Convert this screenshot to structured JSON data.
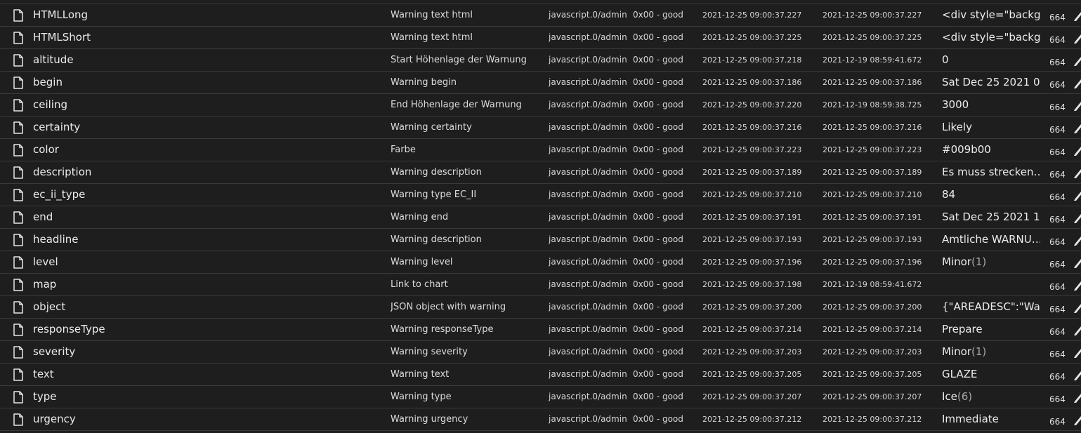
{
  "permission": "664",
  "rows": [
    {
      "name": "HTMLLong",
      "description": "Warning text html",
      "from": "javascript.0/admin",
      "quality": "0x00 - good",
      "timestamp": "2021-12-25 09:00:37.227",
      "last_change": "2021-12-25 09:00:37.227",
      "value": "<div style=\"backg…",
      "value_ann": ""
    },
    {
      "name": "HTMLShort",
      "description": "Warning text html",
      "from": "javascript.0/admin",
      "quality": "0x00 - good",
      "timestamp": "2021-12-25 09:00:37.225",
      "last_change": "2021-12-25 09:00:37.225",
      "value": "<div style=\"backg…",
      "value_ann": ""
    },
    {
      "name": "altitude",
      "description": "Start Höhenlage der Warnung",
      "from": "javascript.0/admin",
      "quality": "0x00 - good",
      "timestamp": "2021-12-25 09:00:37.218",
      "last_change": "2021-12-19 08:59:41.672",
      "value": "0",
      "value_ann": ""
    },
    {
      "name": "begin",
      "description": "Warning begin",
      "from": "javascript.0/admin",
      "quality": "0x00 - good",
      "timestamp": "2021-12-25 09:00:37.186",
      "last_change": "2021-12-25 09:00:37.186",
      "value": "Sat Dec 25 2021 0…",
      "value_ann": ""
    },
    {
      "name": "ceiling",
      "description": "End Höhenlage der Warnung",
      "from": "javascript.0/admin",
      "quality": "0x00 - good",
      "timestamp": "2021-12-25 09:00:37.220",
      "last_change": "2021-12-19 08:59:38.725",
      "value": "3000",
      "value_ann": ""
    },
    {
      "name": "certainty",
      "description": "Warning certainty",
      "from": "javascript.0/admin",
      "quality": "0x00 - good",
      "timestamp": "2021-12-25 09:00:37.216",
      "last_change": "2021-12-25 09:00:37.216",
      "value": "Likely",
      "value_ann": ""
    },
    {
      "name": "color",
      "description": "Farbe",
      "from": "javascript.0/admin",
      "quality": "0x00 - good",
      "timestamp": "2021-12-25 09:00:37.223",
      "last_change": "2021-12-25 09:00:37.223",
      "value": "#009b00",
      "value_ann": ""
    },
    {
      "name": "description",
      "description": "Warning description",
      "from": "javascript.0/admin",
      "quality": "0x00 - good",
      "timestamp": "2021-12-25 09:00:37.189",
      "last_change": "2021-12-25 09:00:37.189",
      "value": "Es muss strecken…",
      "value_ann": ""
    },
    {
      "name": "ec_ii_type",
      "description": "Warning type EC_II",
      "from": "javascript.0/admin",
      "quality": "0x00 - good",
      "timestamp": "2021-12-25 09:00:37.210",
      "last_change": "2021-12-25 09:00:37.210",
      "value": "84",
      "value_ann": ""
    },
    {
      "name": "end",
      "description": "Warning end",
      "from": "javascript.0/admin",
      "quality": "0x00 - good",
      "timestamp": "2021-12-25 09:00:37.191",
      "last_change": "2021-12-25 09:00:37.191",
      "value": "Sat Dec 25 2021 1…",
      "value_ann": ""
    },
    {
      "name": "headline",
      "description": "Warning description",
      "from": "javascript.0/admin",
      "quality": "0x00 - good",
      "timestamp": "2021-12-25 09:00:37.193",
      "last_change": "2021-12-25 09:00:37.193",
      "value": "Amtliche WARNU…",
      "value_ann": ""
    },
    {
      "name": "level",
      "description": "Warning level",
      "from": "javascript.0/admin",
      "quality": "0x00 - good",
      "timestamp": "2021-12-25 09:00:37.196",
      "last_change": "2021-12-25 09:00:37.196",
      "value": "Minor",
      "value_ann": "(1)"
    },
    {
      "name": "map",
      "description": "Link to chart",
      "from": "javascript.0/admin",
      "quality": "0x00 - good",
      "timestamp": "2021-12-25 09:00:37.198",
      "last_change": "2021-12-19 08:59:41.672",
      "value": "",
      "value_ann": ""
    },
    {
      "name": "object",
      "description": "JSON object with warning",
      "from": "javascript.0/admin",
      "quality": "0x00 - good",
      "timestamp": "2021-12-25 09:00:37.200",
      "last_change": "2021-12-25 09:00:37.200",
      "value": "{\"AREADESC\":\"Wa…",
      "value_ann": ""
    },
    {
      "name": "responseType",
      "description": "Warning responseType",
      "from": "javascript.0/admin",
      "quality": "0x00 - good",
      "timestamp": "2021-12-25 09:00:37.214",
      "last_change": "2021-12-25 09:00:37.214",
      "value": "Prepare",
      "value_ann": ""
    },
    {
      "name": "severity",
      "description": "Warning severity",
      "from": "javascript.0/admin",
      "quality": "0x00 - good",
      "timestamp": "2021-12-25 09:00:37.203",
      "last_change": "2021-12-25 09:00:37.203",
      "value": "Minor",
      "value_ann": "(1)"
    },
    {
      "name": "text",
      "description": "Warning text",
      "from": "javascript.0/admin",
      "quality": "0x00 - good",
      "timestamp": "2021-12-25 09:00:37.205",
      "last_change": "2021-12-25 09:00:37.205",
      "value": "GLAZE",
      "value_ann": ""
    },
    {
      "name": "type",
      "description": "Warning type",
      "from": "javascript.0/admin",
      "quality": "0x00 - good",
      "timestamp": "2021-12-25 09:00:37.207",
      "last_change": "2021-12-25 09:00:37.207",
      "value": "Ice",
      "value_ann": "(6)"
    },
    {
      "name": "urgency",
      "description": "Warning urgency",
      "from": "javascript.0/admin",
      "quality": "0x00 - good",
      "timestamp": "2021-12-25 09:00:37.212",
      "last_change": "2021-12-25 09:00:37.212",
      "value": "Immediate",
      "value_ann": ""
    }
  ]
}
